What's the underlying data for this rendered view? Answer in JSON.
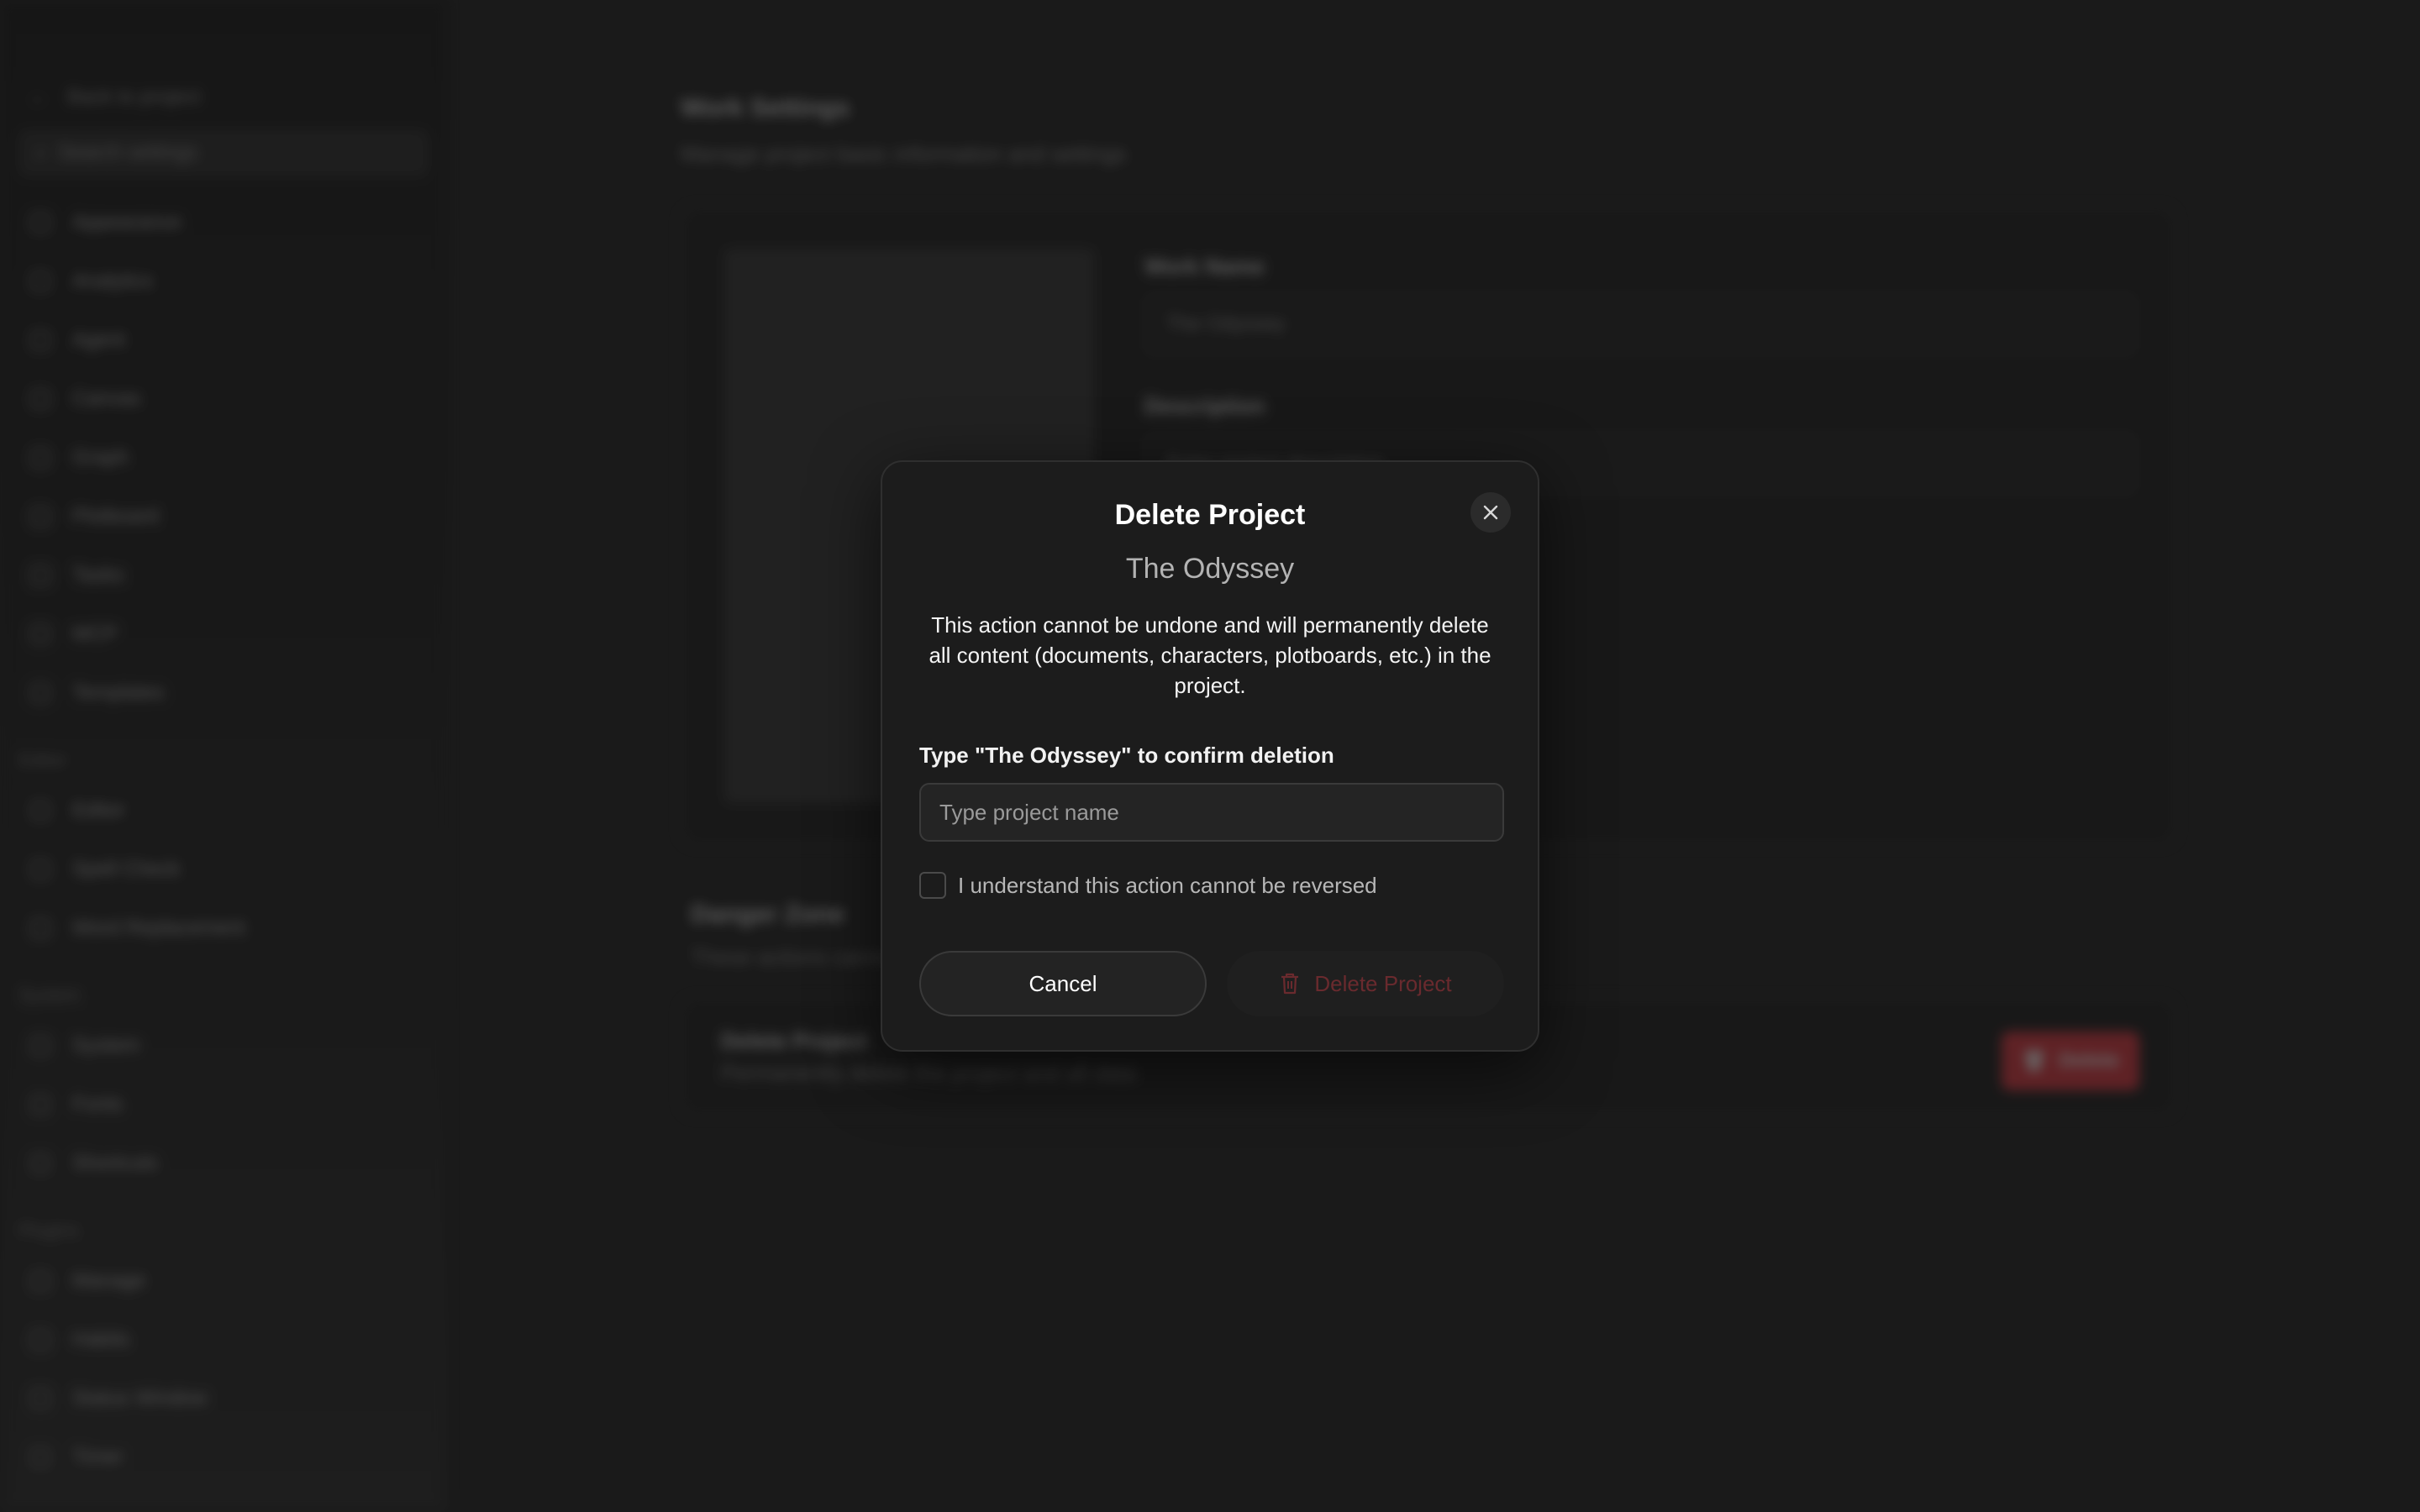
{
  "sidebar": {
    "back_label": "Back to project",
    "search_label": "Search settings",
    "items_main": [
      {
        "label": "Appearance",
        "icon": "appearance-icon"
      },
      {
        "label": "Analytics",
        "icon": "analytics-icon"
      },
      {
        "label": "Agent",
        "icon": "agent-icon"
      },
      {
        "label": "Canvas",
        "icon": "canvas-icon"
      },
      {
        "label": "Graph",
        "icon": "graph-icon"
      },
      {
        "label": "Plotboard",
        "icon": "plotboard-icon"
      },
      {
        "label": "Tasks",
        "icon": "tasks-icon"
      },
      {
        "label": "MCP",
        "icon": "mcp-icon"
      },
      {
        "label": "Templates",
        "icon": "templates-icon"
      }
    ],
    "section_editor": "Editor",
    "items_editor": [
      {
        "label": "Editor",
        "icon": "editor-icon"
      },
      {
        "label": "Spell Check",
        "icon": "spell-check-icon"
      },
      {
        "label": "Word Replacement",
        "icon": "word-replacement-icon"
      }
    ],
    "section_system": "System",
    "items_system": [
      {
        "label": "System",
        "icon": "system-icon"
      },
      {
        "label": "Fonts",
        "icon": "fonts-icon"
      },
      {
        "label": "Shortcuts",
        "icon": "shortcuts-icon"
      }
    ],
    "section_plugins": "Plugins",
    "items_plugins": [
      {
        "label": "Manage",
        "icon": "manage-icon"
      },
      {
        "label": "Habits",
        "icon": "habits-icon"
      },
      {
        "label": "Status Window",
        "icon": "status-window-icon"
      },
      {
        "label": "Timer",
        "icon": "timer-icon"
      }
    ]
  },
  "main": {
    "title": "Work Settings",
    "subtitle": "Manage project basic information and settings",
    "work_name_label": "Work Name",
    "work_name_value": "The Odyssey",
    "description_label": "Description",
    "description_placeholder": "Enter project description",
    "danger_title": "Danger Zone",
    "danger_subtitle": "These actions cannot be undone",
    "delete_card_title": "Delete Project",
    "delete_card_subtitle": "Permanently delete the project and all data",
    "delete_card_button": "Delete"
  },
  "dialog": {
    "title": "Delete Project",
    "project_name": "The Odyssey",
    "warning": "This action cannot be undone and will permanently delete all content (documents, characters, plotboards, etc.) in the project.",
    "confirm_label": "Type \"The Odyssey\" to confirm deletion",
    "input_placeholder": "Type project name",
    "input_value": "",
    "checkbox_label": "I understand this action cannot be reversed",
    "checkbox_checked": false,
    "cancel_label": "Cancel",
    "delete_label": "Delete Project",
    "delete_enabled": false
  },
  "colors": {
    "background": "#1f1f1f",
    "dialog_background": "#1c1c1c",
    "danger": "#e0353f",
    "danger_disabled_text": "#6a2a2e"
  }
}
